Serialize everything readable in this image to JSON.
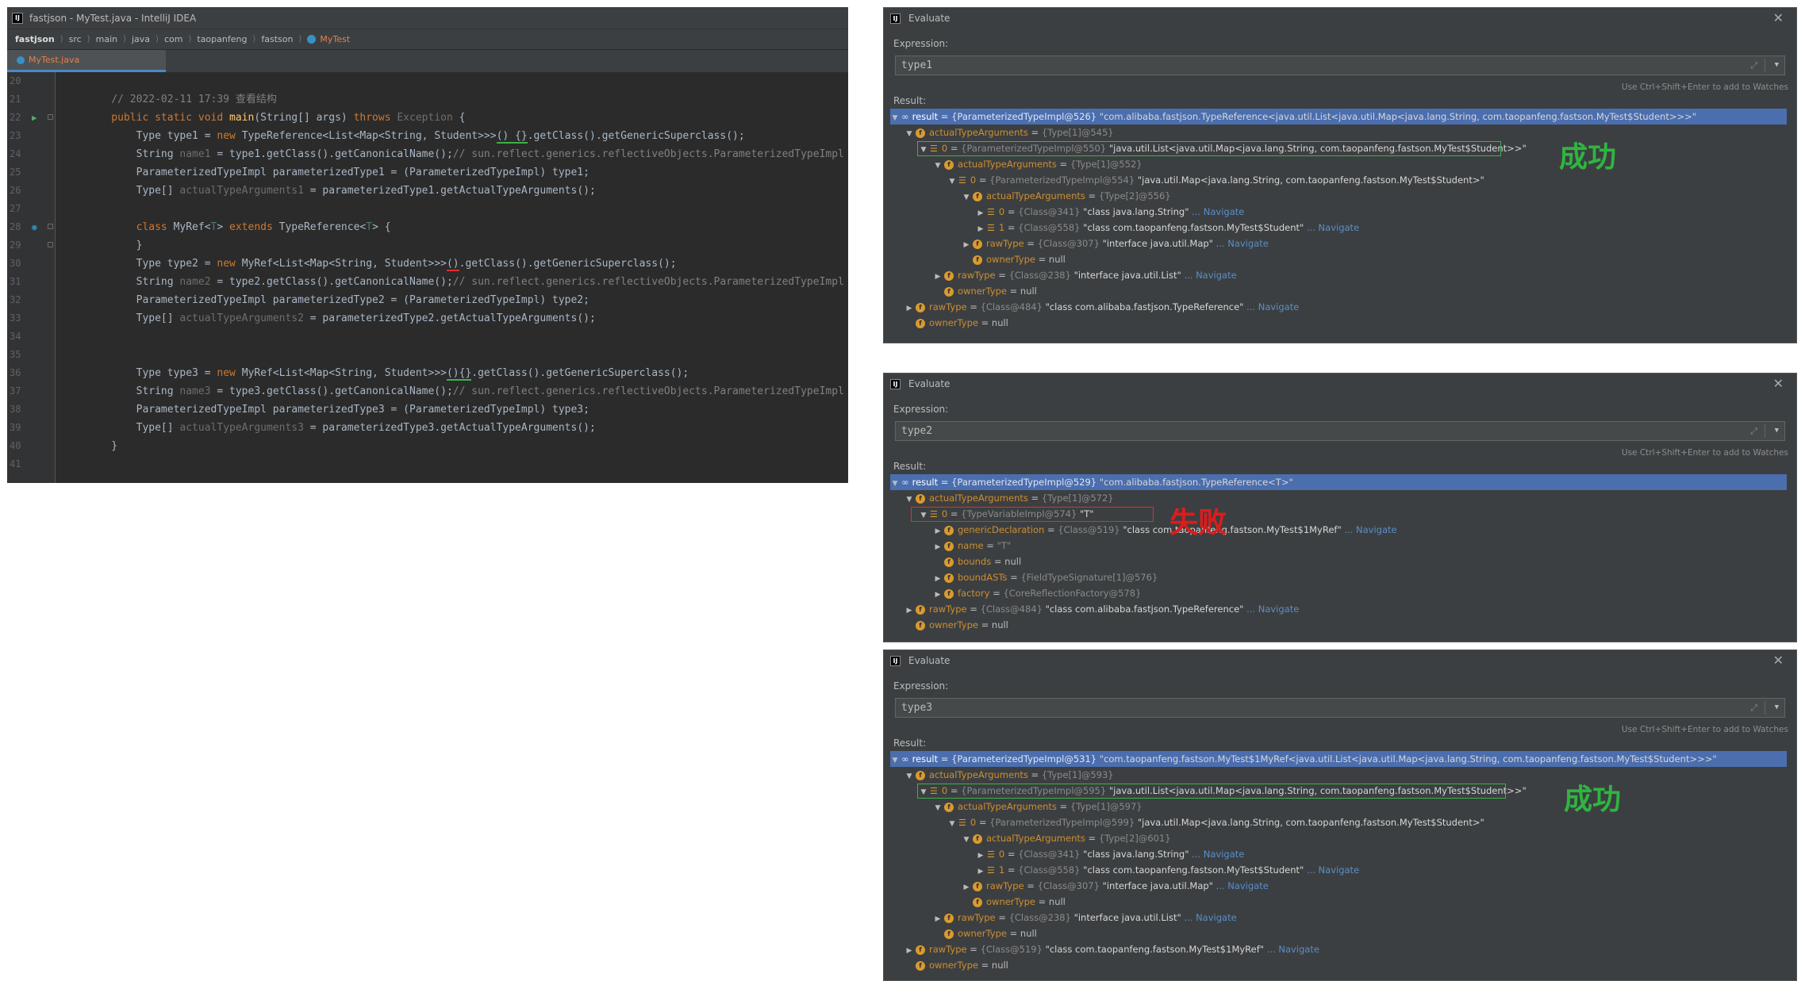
{
  "ide": {
    "title": "fastjson - MyTest.java - IntelliJ IDEA",
    "breadcrumbs": [
      "fastjson",
      "src",
      "main",
      "java",
      "com",
      "taopanfeng",
      "fastson",
      "MyTest"
    ],
    "tab": "MyTest.java",
    "lines": [
      {
        "n": "20",
        "segs": []
      },
      {
        "n": "21",
        "segs": [
          {
            "t": "    // 2022-02-11 17:39 查看结构",
            "c": "cm"
          }
        ]
      },
      {
        "n": "22",
        "segs": [
          {
            "t": "    public static void ",
            "c": "kw"
          },
          {
            "t": "main",
            "c": "fn"
          },
          {
            "t": "(String[] args) "
          },
          {
            "t": "throws ",
            "c": "kw"
          },
          {
            "t": "Exception",
            "c": "gray"
          },
          {
            "t": " {"
          }
        ]
      },
      {
        "n": "23",
        "segs": [
          {
            "t": "        Type type1 = "
          },
          {
            "t": "new ",
            "c": "kw"
          },
          {
            "t": "TypeReference<List<Map<String, Student>>>"
          },
          {
            "t": "() {}",
            "c": "uline-green"
          },
          {
            "t": ".getClass().getGenericSuperclass();"
          }
        ]
      },
      {
        "n": "24",
        "segs": [
          {
            "t": "        String "
          },
          {
            "t": "name1",
            "c": "gray"
          },
          {
            "t": " = type1.getClass().getCanonicalName();"
          },
          {
            "t": "// sun.reflect.generics.reflectiveObjects.ParameterizedTypeImpl",
            "c": "cm"
          }
        ]
      },
      {
        "n": "25",
        "segs": [
          {
            "t": "        ParameterizedTypeImpl parameterizedType1 = (ParameterizedTypeImpl) type1;"
          }
        ]
      },
      {
        "n": "26",
        "segs": [
          {
            "t": "        Type[] "
          },
          {
            "t": "actualTypeArguments1",
            "c": "gray"
          },
          {
            "t": " = parameterizedType1.getActualTypeArguments();"
          }
        ]
      },
      {
        "n": "27",
        "segs": []
      },
      {
        "n": "28",
        "segs": [
          {
            "t": "        class ",
            "c": "kw"
          },
          {
            "t": "MyRef<"
          },
          {
            "t": "T",
            "c": "tp"
          },
          {
            "t": "> "
          },
          {
            "t": "extends ",
            "c": "kw"
          },
          {
            "t": "TypeReference<"
          },
          {
            "t": "T",
            "c": "tp"
          },
          {
            "t": "> {"
          }
        ]
      },
      {
        "n": "29",
        "segs": [
          {
            "t": "        }"
          }
        ]
      },
      {
        "n": "30",
        "segs": [
          {
            "t": "        Type type2 = "
          },
          {
            "t": "new ",
            "c": "kw"
          },
          {
            "t": "MyRef<List<Map<String, Student>>>"
          },
          {
            "t": "()",
            "c": "uline-red"
          },
          {
            "t": ".getClass().getGenericSuperclass();"
          }
        ]
      },
      {
        "n": "31",
        "segs": [
          {
            "t": "        String "
          },
          {
            "t": "name2",
            "c": "gray"
          },
          {
            "t": " = type2.getClass().getCanonicalName();"
          },
          {
            "t": "// sun.reflect.generics.reflectiveObjects.ParameterizedTypeImpl",
            "c": "cm"
          }
        ]
      },
      {
        "n": "32",
        "segs": [
          {
            "t": "        ParameterizedTypeImpl parameterizedType2 = (ParameterizedTypeImpl) type2;"
          }
        ]
      },
      {
        "n": "33",
        "segs": [
          {
            "t": "        Type[] "
          },
          {
            "t": "actualTypeArguments2",
            "c": "gray"
          },
          {
            "t": " = parameterizedType2.getActualTypeArguments();"
          }
        ]
      },
      {
        "n": "34",
        "segs": []
      },
      {
        "n": "35",
        "segs": []
      },
      {
        "n": "36",
        "segs": [
          {
            "t": "        Type type3 = "
          },
          {
            "t": "new ",
            "c": "kw"
          },
          {
            "t": "MyRef<List<Map<String, Student>>>"
          },
          {
            "t": "(){}",
            "c": "uline-green"
          },
          {
            "t": ".getClass().getGenericSuperclass();"
          }
        ]
      },
      {
        "n": "37",
        "segs": [
          {
            "t": "        String "
          },
          {
            "t": "name3",
            "c": "gray"
          },
          {
            "t": " = type3.getClass().getCanonicalName();"
          },
          {
            "t": "// sun.reflect.generics.reflectiveObjects.ParameterizedTypeImpl",
            "c": "cm"
          }
        ]
      },
      {
        "n": "38",
        "segs": [
          {
            "t": "        ParameterizedTypeImpl parameterizedType3 = (ParameterizedTypeImpl) type3;"
          }
        ]
      },
      {
        "n": "39",
        "segs": [
          {
            "t": "        Type[] "
          },
          {
            "t": "actualTypeArguments3",
            "c": "gray"
          },
          {
            "t": " = parameterizedType3.getActualTypeArguments();"
          }
        ]
      },
      {
        "n": "40",
        "segs": [
          {
            "t": "    }"
          }
        ]
      },
      {
        "n": "41",
        "segs": []
      }
    ]
  },
  "dialogs": [
    {
      "title": "Evaluate",
      "expression_label": "Expression:",
      "expression": "type1",
      "hint": "Use Ctrl+Shift+Enter to add to Watches",
      "result_label": "Result:",
      "annotation": "成功",
      "annotation_color": "#2fb540",
      "rows": [
        {
          "d": 0,
          "a": "open",
          "i": "oo",
          "name": "result",
          "ref": "{ParameterizedTypeImpl@526}",
          "val": "\"com.alibaba.fastjson.TypeReference<java.util.List<java.util.Map<java.lang.String, com.taopanfeng.fastson.MyTest$Student>>>\"",
          "sel": true
        },
        {
          "d": 1,
          "a": "open",
          "i": "f",
          "name": "actualTypeArguments",
          "ref": "{Type[1]@545}"
        },
        {
          "d": 2,
          "a": "open",
          "i": "arr",
          "name": "0",
          "ref": "{ParameterizedTypeImpl@550}",
          "val": "\"java.util.List<java.util.Map<java.lang.String, com.taopanfeng.fastson.MyTest$Student>>\"",
          "box": true
        },
        {
          "d": 3,
          "a": "open",
          "i": "f",
          "name": "actualTypeArguments",
          "ref": "{Type[1]@552}"
        },
        {
          "d": 4,
          "a": "open",
          "i": "arr",
          "name": "0",
          "ref": "{ParameterizedTypeImpl@554}",
          "val": "\"java.util.Map<java.lang.String, com.taopanfeng.fastson.MyTest$Student>\""
        },
        {
          "d": 5,
          "a": "open",
          "i": "f",
          "name": "actualTypeArguments",
          "ref": "{Type[2]@556}"
        },
        {
          "d": 6,
          "a": "closed",
          "i": "arr",
          "name": "0",
          "ref": "{Class@341}",
          "val": "\"class java.lang.String\"",
          "nav": "... Navigate"
        },
        {
          "d": 6,
          "a": "closed",
          "i": "arr",
          "name": "1",
          "ref": "{Class@558}",
          "val": "\"class com.taopanfeng.fastson.MyTest$Student\"",
          "nav": "... Navigate"
        },
        {
          "d": 5,
          "a": "closed",
          "i": "f",
          "name": "rawType",
          "ref": "{Class@307}",
          "val": "\"interface java.util.Map\"",
          "nav": "... Navigate"
        },
        {
          "d": 5,
          "a": "none",
          "i": "f",
          "name": "ownerType",
          "plain": "null"
        },
        {
          "d": 3,
          "a": "closed",
          "i": "f",
          "name": "rawType",
          "ref": "{Class@238}",
          "val": "\"interface java.util.List\"",
          "nav": "... Navigate"
        },
        {
          "d": 3,
          "a": "none",
          "i": "f",
          "name": "ownerType",
          "plain": "null"
        },
        {
          "d": 1,
          "a": "closed",
          "i": "f",
          "name": "rawType",
          "ref": "{Class@484}",
          "val": "\"class com.alibaba.fastjson.TypeReference\"",
          "nav": "... Navigate"
        },
        {
          "d": 1,
          "a": "none",
          "i": "f",
          "name": "ownerType",
          "plain": "null"
        }
      ]
    },
    {
      "title": "Evaluate",
      "expression_label": "Expression:",
      "expression": "type2",
      "hint": "Use Ctrl+Shift+Enter to add to Watches",
      "result_label": "Result:",
      "annotation": "失败",
      "annotation_color": "#e01b1b",
      "rows": [
        {
          "d": 0,
          "a": "open",
          "i": "oo",
          "name": "result",
          "ref": "{ParameterizedTypeImpl@529}",
          "val": "\"com.alibaba.fastjson.TypeReference<T>\"",
          "sel": true
        },
        {
          "d": 1,
          "a": "open",
          "i": "f",
          "name": "actualTypeArguments",
          "ref": "{Type[1]@572}"
        },
        {
          "d": 2,
          "a": "open",
          "i": "arr",
          "name": "0",
          "ref": "{TypeVariableImpl@574}",
          "val": "\"T\"",
          "box": true
        },
        {
          "d": 3,
          "a": "closed",
          "i": "f",
          "name": "genericDeclaration",
          "ref": "{Class@519}",
          "val": "\"class com.taopanfeng.fastson.MyTest$1MyRef\"",
          "nav": "... Navigate"
        },
        {
          "d": 3,
          "a": "closed",
          "i": "f",
          "name": "name",
          "ref": "\"T\""
        },
        {
          "d": 3,
          "a": "none",
          "i": "f",
          "name": "bounds",
          "plain": "null"
        },
        {
          "d": 3,
          "a": "closed",
          "i": "f",
          "name": "boundASTs",
          "ref": "{FieldTypeSignature[1]@576}"
        },
        {
          "d": 3,
          "a": "closed",
          "i": "f",
          "name": "factory",
          "ref": "{CoreReflectionFactory@578}"
        },
        {
          "d": 1,
          "a": "closed",
          "i": "f",
          "name": "rawType",
          "ref": "{Class@484}",
          "val": "\"class com.alibaba.fastjson.TypeReference\"",
          "nav": "... Navigate"
        },
        {
          "d": 1,
          "a": "none",
          "i": "f",
          "name": "ownerType",
          "plain": "null"
        }
      ]
    },
    {
      "title": "Evaluate",
      "expression_label": "Expression:",
      "expression": "type3",
      "hint": "Use Ctrl+Shift+Enter to add to Watches",
      "result_label": "Result:",
      "annotation": "成功",
      "annotation_color": "#2fb540",
      "rows": [
        {
          "d": 0,
          "a": "open",
          "i": "oo",
          "name": "result",
          "ref": "{ParameterizedTypeImpl@531}",
          "val": "\"com.taopanfeng.fastson.MyTest$1MyRef<java.util.List<java.util.Map<java.lang.String, com.taopanfeng.fastson.MyTest$Student>>>\"",
          "sel": true
        },
        {
          "d": 1,
          "a": "open",
          "i": "f",
          "name": "actualTypeArguments",
          "ref": "{Type[1]@593}"
        },
        {
          "d": 2,
          "a": "open",
          "i": "arr",
          "name": "0",
          "ref": "{ParameterizedTypeImpl@595}",
          "val": "\"java.util.List<java.util.Map<java.lang.String, com.taopanfeng.fastson.MyTest$Student>>\"",
          "box": true
        },
        {
          "d": 3,
          "a": "open",
          "i": "f",
          "name": "actualTypeArguments",
          "ref": "{Type[1]@597}"
        },
        {
          "d": 4,
          "a": "open",
          "i": "arr",
          "name": "0",
          "ref": "{ParameterizedTypeImpl@599}",
          "val": "\"java.util.Map<java.lang.String, com.taopanfeng.fastson.MyTest$Student>\""
        },
        {
          "d": 5,
          "a": "open",
          "i": "f",
          "name": "actualTypeArguments",
          "ref": "{Type[2]@601}"
        },
        {
          "d": 6,
          "a": "closed",
          "i": "arr",
          "name": "0",
          "ref": "{Class@341}",
          "val": "\"class java.lang.String\"",
          "nav": "... Navigate"
        },
        {
          "d": 6,
          "a": "closed",
          "i": "arr",
          "name": "1",
          "ref": "{Class@558}",
          "val": "\"class com.taopanfeng.fastson.MyTest$Student\"",
          "nav": "... Navigate"
        },
        {
          "d": 5,
          "a": "closed",
          "i": "f",
          "name": "rawType",
          "ref": "{Class@307}",
          "val": "\"interface java.util.Map\"",
          "nav": "... Navigate"
        },
        {
          "d": 5,
          "a": "none",
          "i": "f",
          "name": "ownerType",
          "plain": "null"
        },
        {
          "d": 3,
          "a": "closed",
          "i": "f",
          "name": "rawType",
          "ref": "{Class@238}",
          "val": "\"interface java.util.List\"",
          "nav": "... Navigate"
        },
        {
          "d": 3,
          "a": "none",
          "i": "f",
          "name": "ownerType",
          "plain": "null"
        },
        {
          "d": 1,
          "a": "closed",
          "i": "f",
          "name": "rawType",
          "ref": "{Class@519}",
          "val": "\"class com.taopanfeng.fastson.MyTest$1MyRef\"",
          "nav": "... Navigate"
        },
        {
          "d": 1,
          "a": "none",
          "i": "f",
          "name": "ownerType",
          "plain": "null"
        }
      ]
    }
  ]
}
